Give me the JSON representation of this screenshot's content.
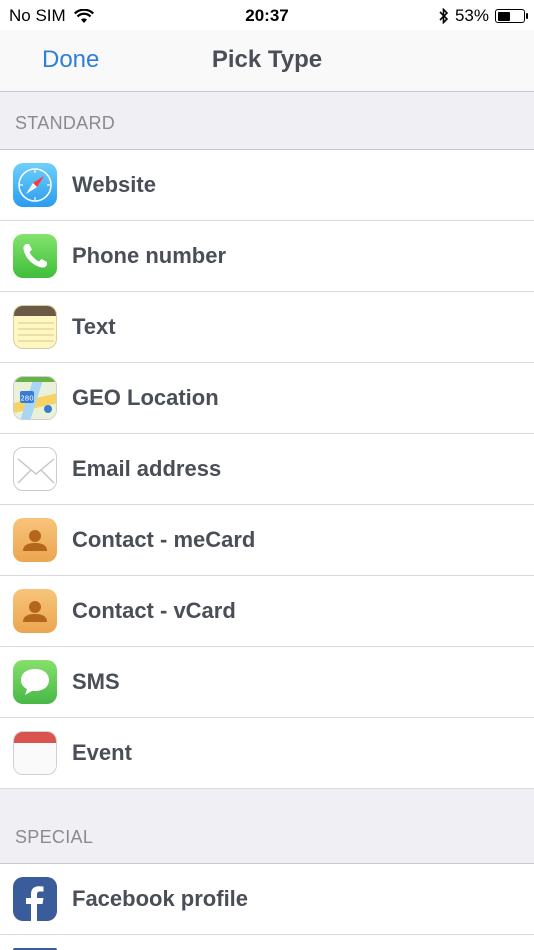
{
  "status_bar": {
    "carrier": "No SIM",
    "time": "20:37",
    "battery_percent_label": "53%",
    "battery_level": 0.53
  },
  "nav": {
    "done_label": "Done",
    "title": "Pick Type"
  },
  "sections": {
    "standard": {
      "header": "STANDARD",
      "items": [
        {
          "label": "Website",
          "icon": "safari-compass-icon"
        },
        {
          "label": "Phone number",
          "icon": "phone-icon"
        },
        {
          "label": "Text",
          "icon": "notes-icon"
        },
        {
          "label": "GEO Location",
          "icon": "maps-icon"
        },
        {
          "label": "Email address",
          "icon": "mail-envelope-icon"
        },
        {
          "label": "Contact - meCard",
          "icon": "contact-person-icon"
        },
        {
          "label": "Contact - vCard",
          "icon": "contact-person-icon"
        },
        {
          "label": "SMS",
          "icon": "message-bubble-icon"
        },
        {
          "label": "Event",
          "icon": "calendar-icon"
        }
      ]
    },
    "special": {
      "header": "SPECIAL",
      "items": [
        {
          "label": "Facebook profile",
          "icon": "facebook-icon"
        }
      ]
    }
  },
  "colors": {
    "accent": "#2f7fd9",
    "text": "#4a4f57",
    "section_text": "#8a8a8f",
    "background": "#efeff4"
  }
}
